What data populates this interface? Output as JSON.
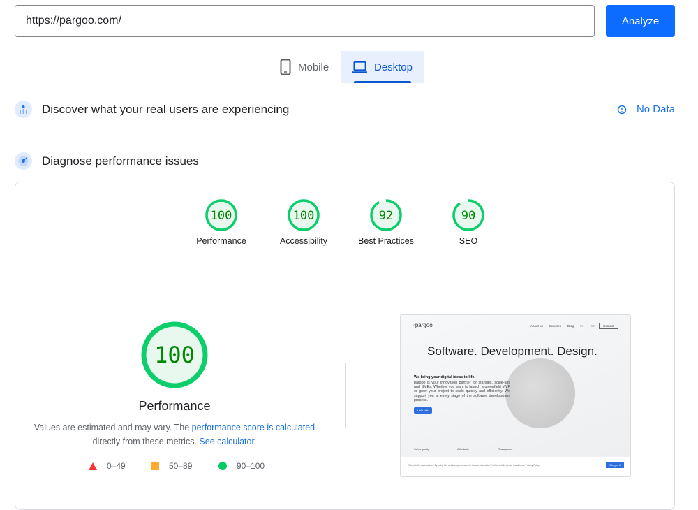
{
  "search": {
    "url": "https://pargoo.com/",
    "analyze_label": "Analyze"
  },
  "tabs": [
    {
      "label": "Mobile",
      "icon": "phone-icon"
    },
    {
      "label": "Desktop",
      "icon": "laptop-icon",
      "selected": true
    }
  ],
  "field_data": {
    "title": "Discover what your real users are experiencing",
    "status": "No Data",
    "icon": "info-icon"
  },
  "lab_data": {
    "title": "Diagnose performance issues"
  },
  "scores": [
    {
      "label": "Performance",
      "value": 100
    },
    {
      "label": "Accessibility",
      "value": 100
    },
    {
      "label": "Best Practices",
      "value": 92
    },
    {
      "label": "SEO",
      "value": 90
    }
  ],
  "main_score": {
    "label": "Performance",
    "value": 100,
    "desc_pre": "Values are estimated and may vary. The ",
    "desc_link1": "performance score is calculated",
    "desc_mid": " directly from these metrics. ",
    "desc_link2": "See calculator",
    "desc_end": "."
  },
  "legend": [
    {
      "range": "0–49",
      "shape": "triangle",
      "color": "#ff3333"
    },
    {
      "range": "50–89",
      "shape": "square",
      "color": "#ffaa33"
    },
    {
      "range": "90–100",
      "shape": "circle",
      "color": "#00cc66"
    }
  ],
  "colors": {
    "pass": "#0cce6b",
    "pass_bg": "#e8f8ef",
    "accent": "#0b6cff"
  },
  "screenshot": {
    "logo": "pargoo",
    "nav": [
      "About us",
      "Services",
      "Blog",
      "EN",
      "DE"
    ],
    "contact": "Contact",
    "headline": "Software. Development. Design.",
    "subhead": "We bring your digital ideas to life.",
    "body": "pargoo is your innovation partner for startups, scale-ups and SMEs. Whether you want to launch a greenfield MVP or grow your project to scale quickly and efficiently. We support you at every stage of the software development process.",
    "cta": "Let's talk",
    "features": [
      "Swiss quality",
      "Affordable",
      "Transparent"
    ],
    "cookie": "This website uses cookies. By using this website, you consent to the use of cookies. Further details can be found in our Privacy Policy.",
    "cookie_ok": "Ok, got it"
  }
}
